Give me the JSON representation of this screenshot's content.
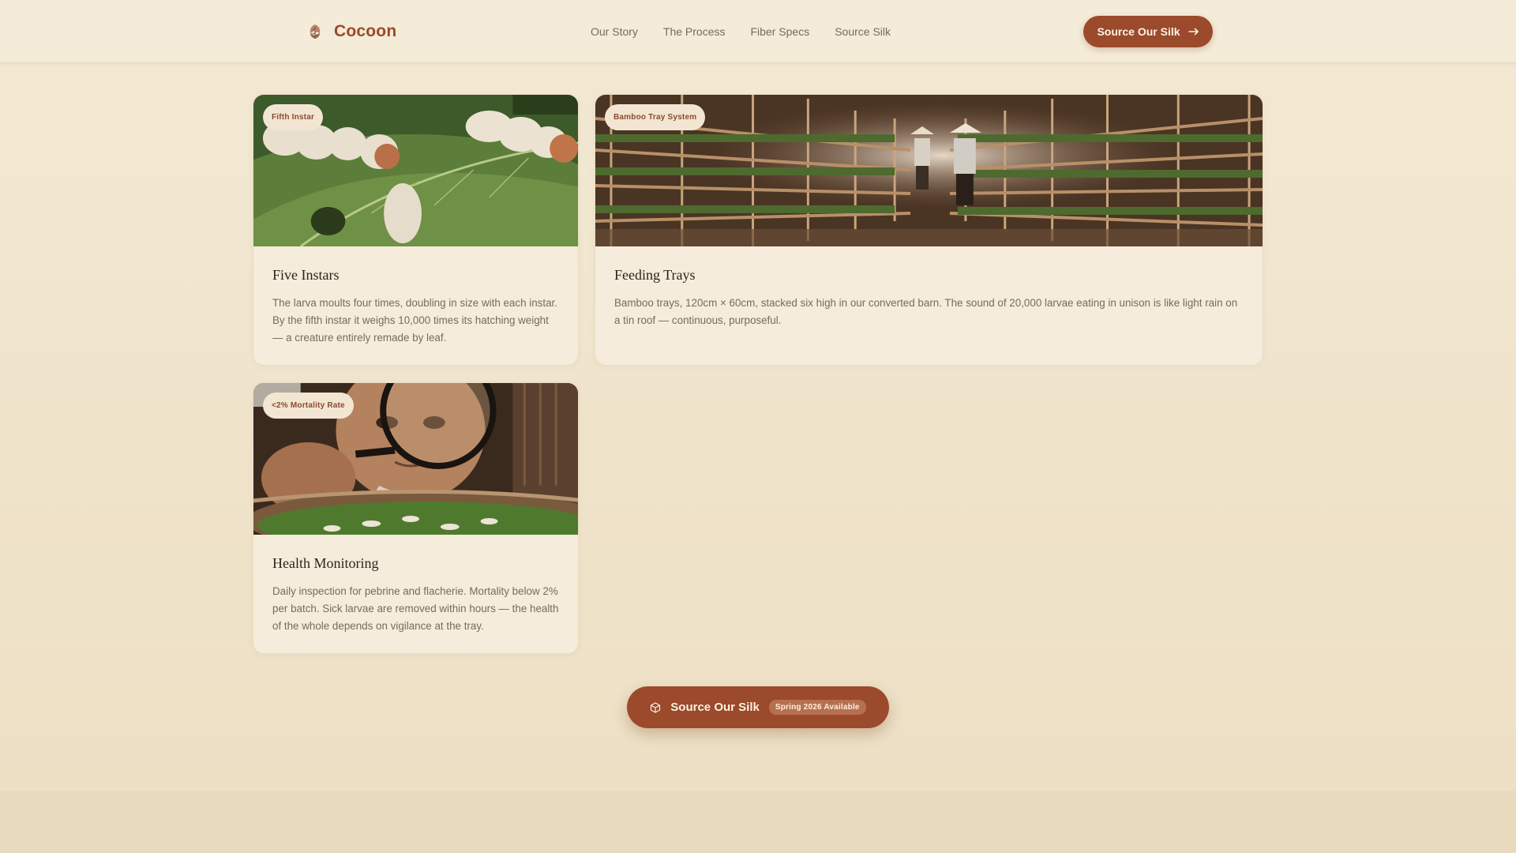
{
  "header": {
    "brand_name": "Cocoon",
    "brand_icon": "leaf-icon",
    "nav": [
      {
        "label": "Our Story"
      },
      {
        "label": "The Process"
      },
      {
        "label": "Fiber Specs"
      },
      {
        "label": "Source Silk"
      }
    ],
    "cta_label": "Source Our Silk",
    "cta_icon": "arrow-right-icon"
  },
  "cards": [
    {
      "badge": "Fifth Instar",
      "title": "Five Instars",
      "text": "The larva moults four times, doubling in size with each instar. By the fifth instar it weighs 10,000 times its hatching weight — a creature entirely remade by leaf."
    },
    {
      "badge": "Bamboo Tray System",
      "title": "Feeding Trays",
      "text": "Bamboo trays, 120cm × 60cm, stacked six high in our converted barn. The sound of 20,000 larvae eating in unison is like light rain on a tin roof — continuous, purposeful."
    },
    {
      "badge": "<2% Mortality Rate",
      "title": "Health Monitoring",
      "text": "Daily inspection for pebrine and flacherie. Mortality below 2% per batch. Sick larvae are removed within hours — the health of the whole depends on vigilance at the tray."
    }
  ],
  "bottom_cta": {
    "label": "Source Our Silk",
    "pill": "Spring 2026 Available",
    "icon": "cube-icon"
  },
  "colors": {
    "accent": "#9b4a2b",
    "background": "#efe4cd",
    "card": "#f5ecdc",
    "text_muted": "#7a6a5c"
  }
}
